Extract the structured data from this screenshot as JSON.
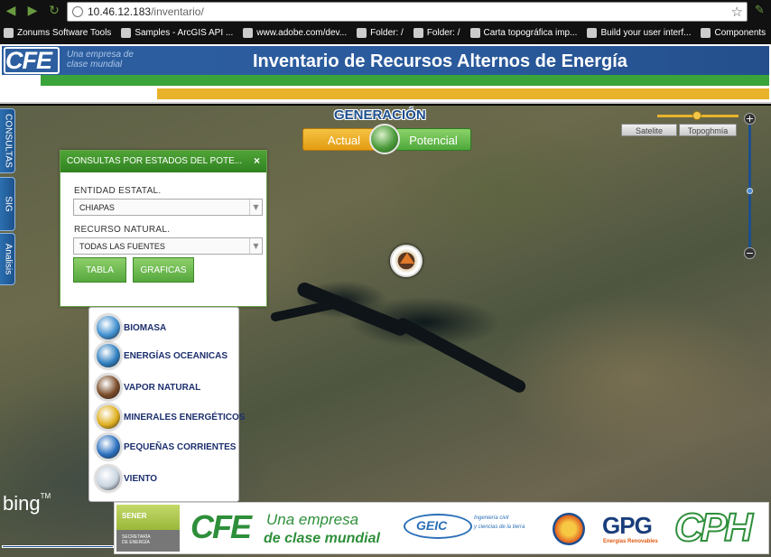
{
  "browser": {
    "url_host": "10.46.12.183",
    "url_path": "/inventario/",
    "bookmarks": [
      {
        "label": "Zonums Software Tools",
        "icon": "zonums-icon"
      },
      {
        "label": "Samples - ArcGIS API ...",
        "icon": "arcgis-icon"
      },
      {
        "label": "www.adobe.com/dev...",
        "icon": "adobe-icon"
      },
      {
        "label": "Folder: /",
        "icon": "page-icon"
      },
      {
        "label": "Folder: /",
        "icon": "page-icon"
      },
      {
        "label": "Carta topográfica imp...",
        "icon": "inegi-icon"
      },
      {
        "label": "Build your user interf...",
        "icon": "adobe-icon"
      },
      {
        "label": "Components",
        "icon": "components-icon"
      }
    ]
  },
  "header": {
    "logo": "CFE",
    "tagline_1": "Una empresa de",
    "tagline_2": "clase mundial",
    "title": "Inventario de Recursos Alternos de Energía",
    "colors": {
      "blue": "#2d5fa0",
      "green": "#3aa33a",
      "yellow": "#e8b32a"
    }
  },
  "side_tabs": [
    "CONSULTAS",
    "SIG",
    "Analisis"
  ],
  "generation": {
    "title": "GENERACIÓN",
    "actual_label": "Actual",
    "potencial_label": "Potencial"
  },
  "map_controls": {
    "satellite_label": "Satelite",
    "topography_label": "Topoghmía",
    "zoom_in": "+",
    "zoom_out": "−"
  },
  "panel": {
    "title": "CONSULTAS POR ESTADOS DEL POTE...",
    "close": "×",
    "state_label": "ENTIDAD ESTATAL.",
    "state_value": "CHIAPAS",
    "resource_label": "RECURSO NATURAL.",
    "resource_value": "TODAS LAS FUENTES",
    "table_button": "TABLA",
    "charts_button": "GRAFICAS"
  },
  "legend": [
    {
      "label": "BIOMASA",
      "color": "#3f8fd0"
    },
    {
      "label": "ENERGÍAS OCEANICAS",
      "color": "#2f7fc0"
    },
    {
      "label": "VAPOR NATURAL",
      "color": "#7a4a28"
    },
    {
      "label": "MINERALES ENERGÉTICOS",
      "color": "#e0b020"
    },
    {
      "label": "PEQUEÑAS CORRIENTES",
      "color": "#2a70c0"
    },
    {
      "label": "VIENTO",
      "color": "#c8d4e0"
    }
  ],
  "map": {
    "provider": "bing",
    "provider_tm": "TM"
  },
  "footer": {
    "sener": "SENER",
    "sener_sub_1": "SECRETARÍA",
    "sener_sub_2": "DE ENERGÍA",
    "cfe": "CFE",
    "cfe_tag_1": "Una empresa",
    "cfe_tag_2": "de clase mundial",
    "geic": "GEIC",
    "geic_sub_1": "Ingeniería civil",
    "geic_sub_2": "y ciencias de la tierra",
    "gpg": "GPG",
    "gpg_sub": "Energías Renovables",
    "cph": "CPH"
  }
}
